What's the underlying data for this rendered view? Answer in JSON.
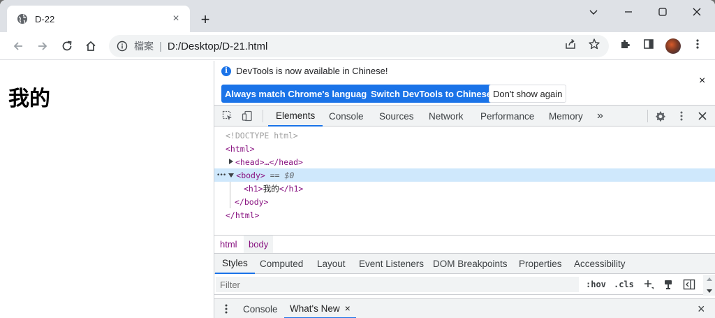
{
  "browser": {
    "tab_title": "D-22",
    "new_tab_symbol": "+",
    "tab_close_symbol": "×",
    "omnibox_label": "檔案",
    "omnibox_separator": "|",
    "url": "D:/Desktop/D-21.html"
  },
  "page": {
    "heading": "我的"
  },
  "devtools": {
    "infobar": {
      "message": "DevTools is now available in Chinese!",
      "btn_match": "Always match Chrome's language",
      "btn_switch": "Switch DevTools to Chinese",
      "btn_dismiss": "Don't show again",
      "close_symbol": "×"
    },
    "tabs": [
      "Elements",
      "Console",
      "Sources",
      "Network",
      "Performance",
      "Memory"
    ],
    "more_tabs_symbol": "»",
    "elements": {
      "doctype": "<!DOCTYPE html>",
      "html_open": "<html>",
      "head_collapsed": "<head>…</head>",
      "body_open": "<body>",
      "body_marker": " == $0",
      "h1_open": "<h1>",
      "h1_text": "我的",
      "h1_close": "</h1>",
      "body_close": "</body>",
      "html_close": "</html>",
      "dots": "•••"
    },
    "breadcrumbs": [
      "html",
      "body"
    ],
    "styles_tabs": [
      "Styles",
      "Computed",
      "Layout",
      "Event Listeners",
      "DOM Breakpoints",
      "Properties",
      "Accessibility"
    ],
    "filter_placeholder": "Filter",
    "filter_hov": ":hov",
    "filter_cls": ".cls",
    "drawer_tabs": [
      "Console",
      "What's New"
    ],
    "drawer_tab_close": "×",
    "drawer_close": "×"
  },
  "colors": {
    "accent": "#1a73e8",
    "tag": "#881280",
    "selection": "#cfe8fc"
  }
}
